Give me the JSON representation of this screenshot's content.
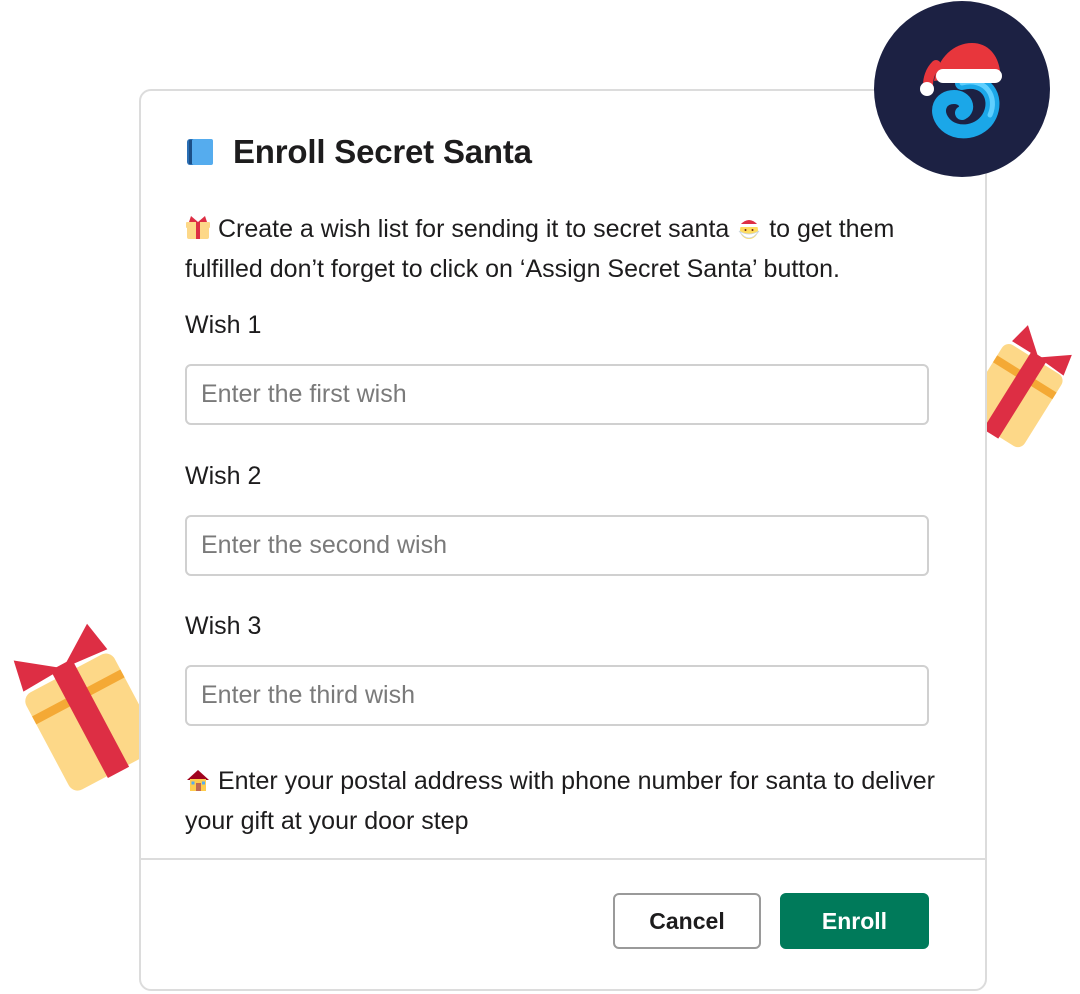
{
  "dialog": {
    "title": "Enroll Secret Santa",
    "title_icon": "blue-book-icon",
    "intro": {
      "gift_icon": "wrapped-gift-icon",
      "text_before": " Create a wish list for sending it to secret santa ",
      "santa_icon": "santa-icon",
      "text_after": " to get them fulfilled don’t forget to click on ‘Assign Secret Santa’ button."
    },
    "fields": [
      {
        "label": "Wish 1",
        "placeholder": "Enter the first wish",
        "value": ""
      },
      {
        "label": "Wish 2",
        "placeholder": "Enter the second wish",
        "value": ""
      },
      {
        "label": "Wish 3",
        "placeholder": "Enter the third wish",
        "value": ""
      }
    ],
    "address_note": {
      "house_icon": "house-icon",
      "text": " Enter your postal address with phone number for santa to deliver your gift at your door step"
    },
    "buttons": {
      "cancel_label": "Cancel",
      "enroll_label": "Enroll"
    }
  },
  "branding": {
    "logo_icon": "santa-hat-swirl-logo",
    "logo_bg_color": "#1c2143"
  },
  "decorations": [
    "gift-box-icon",
    "gift-box-icon"
  ],
  "colors": {
    "primary_button": "#007a5a",
    "gift_ribbon": "#dd2e44",
    "gift_box": "#fdd888"
  }
}
